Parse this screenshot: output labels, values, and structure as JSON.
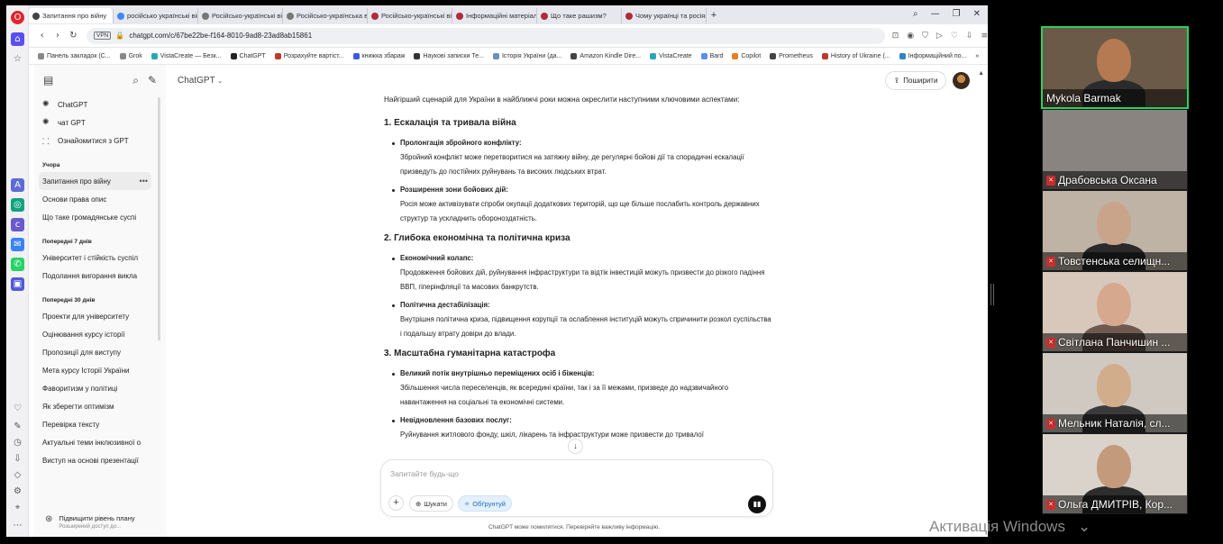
{
  "browser": {
    "tabs": [
      {
        "label": "Запитання про війну",
        "color": "#444"
      },
      {
        "label": "російсько українські війн",
        "color": "#4285f4"
      },
      {
        "label": "Російсько-українські війн",
        "color": "#555"
      },
      {
        "label": "Російсько-українська війн",
        "color": "#555"
      },
      {
        "label": "Російсько-українські війн",
        "color": "#b02a37"
      },
      {
        "label": "Інформаційні матеріали",
        "color": "#b02a37"
      },
      {
        "label": "Що таке рашизм?",
        "color": "#b02a37"
      },
      {
        "label": "Чому українці та росіяни",
        "color": "#b02a37"
      }
    ],
    "new_tab": "+",
    "url": "chatgpt.com/c/67be22be-f164-8010-9ad8-23ad8ab15861",
    "vpn": "VPN",
    "bookmarks": [
      "Панель закладок (С...",
      "Grok",
      "VistaCreate — Безк...",
      "ChatGPT",
      "Розрахуйте вартіст...",
      "книжка збараж",
      "Наукові записки Те...",
      "Історія України (да...",
      "Amazon Kindle Dire...",
      "VistaCreate",
      "Bard",
      "Copilot",
      "Prometheus",
      "History of Ukraine (...",
      "Інформаційний по..."
    ],
    "bookmarks_more": "»"
  },
  "sidebar": {
    "top_links": [
      {
        "label": "ChatGPT",
        "icon": "openai-icon"
      },
      {
        "label": "чат GPT",
        "icon": "openai-icon"
      },
      {
        "label": "Ознайомитися з GPT",
        "icon": "grid-icon"
      }
    ],
    "sections": [
      {
        "title": "Учора",
        "items": [
          "Запитання про війну",
          "Основи права опис",
          "Що таке громадянське суспі"
        ]
      },
      {
        "title": "Попередні 7 днів",
        "items": [
          "Університет і стійкість суспіл",
          "Подолання вигорання викла"
        ]
      },
      {
        "title": "Попередні 30 днів",
        "items": [
          "Проекти для університету",
          "Оцінювання курсу історії",
          "Пропозиції для виступу",
          "Мета курсу Історії України",
          "Фаворитизм у політиці",
          "Як зберегти оптимізм",
          "Перевірка тексту",
          "Актуальні теми інклюзивної о",
          "Виступ на основі презентації"
        ]
      }
    ],
    "selected_dots": "•••",
    "upgrade_title": "Підвищити рівень плану",
    "upgrade_sub": "Розширений доступ до..."
  },
  "main": {
    "title": "ChatGPT",
    "share": "Поширити",
    "intro": "Найгірший сценарій для України в найближчі роки можна окреслити наступними ключовими аспектами:",
    "sections": [
      {
        "heading": "1. Ескалація та тривала війна",
        "items": [
          {
            "title": "Пролонгація збройного конфлікту:",
            "text": "Збройний конфлікт може перетворитися на затяжну війну, де регулярні бойові дії та спорадичні ескалації призведуть до постійних руйнувань та високих людських втрат."
          },
          {
            "title": "Розширення зони бойових дій:",
            "text": "Росія може активізувати спроби окупації додаткових територій, що ще більше послабить контроль державних структур та ускладнить обороноздатність."
          }
        ]
      },
      {
        "heading": "2. Глибока економічна та політична криза",
        "items": [
          {
            "title": "Економічний колапс:",
            "text": "Продовження бойових дій, руйнування інфраструктури та відтік інвестицій можуть призвести до різкого падіння ВВП, гіперінфляції та масових банкрутств."
          },
          {
            "title": "Політична дестабілізація:",
            "text": "Внутрішня політична криза, підвищення корупції та ослаблення інституцій можуть спричинити розкол суспільства і подальшу втрату довіри до влади."
          }
        ]
      },
      {
        "heading": "3. Масштабна гуманітарна катастрофа",
        "items": [
          {
            "title": "Великий потік внутрішньо переміщених осіб і біженців:",
            "text": "Збільшення числа переселенців, як всередині країни, так і за її межами, призведе до надзвичайного навантаження на соціальні та економічні системи."
          },
          {
            "title": "Невідновлення базових послуг:",
            "text": "Руйнування житлового фонду, шкіл, лікарень та інфраструктури може призвести до тривалої"
          }
        ]
      }
    ],
    "composer_placeholder": "Запитайте будь-що",
    "search_pill": "Шукати",
    "reason_pill": "Обґрунтуй",
    "disclaimer": "ChatGPT може помилятися. Перевіряйте важливу інформацію."
  },
  "participants": [
    {
      "name": "Mykola Barmak",
      "muted": false,
      "bg": "#6b5a48",
      "skin": "#b57a52",
      "shirt": "#2b2b2b"
    },
    {
      "name": "Драбовська Оксана",
      "muted": true,
      "bg": "#8a8480",
      "skin": "#8a8480",
      "shirt": "#8a8480"
    },
    {
      "name": "Товстенська селищн...",
      "muted": true,
      "bg": "#bfb3a6",
      "skin": "#caa38b",
      "shirt": "#2a2a2a"
    },
    {
      "name": "Світлана Панчишин ...",
      "muted": true,
      "bg": "#d8c8bb",
      "skin": "#d6a88e",
      "shirt": "#6e5a4e"
    },
    {
      "name": "Мельник Наталія, сл...",
      "muted": true,
      "bg": "#cfc9c1",
      "skin": "#d2ad8c",
      "shirt": "#3b3b3b"
    },
    {
      "name": "Ольга ДМИТРІВ, Кор...",
      "muted": true,
      "bg": "#d9d3cb",
      "skin": "#c49a7d",
      "shirt": "#2d2d2d"
    }
  ],
  "os": {
    "activation": "Активація Windows"
  }
}
